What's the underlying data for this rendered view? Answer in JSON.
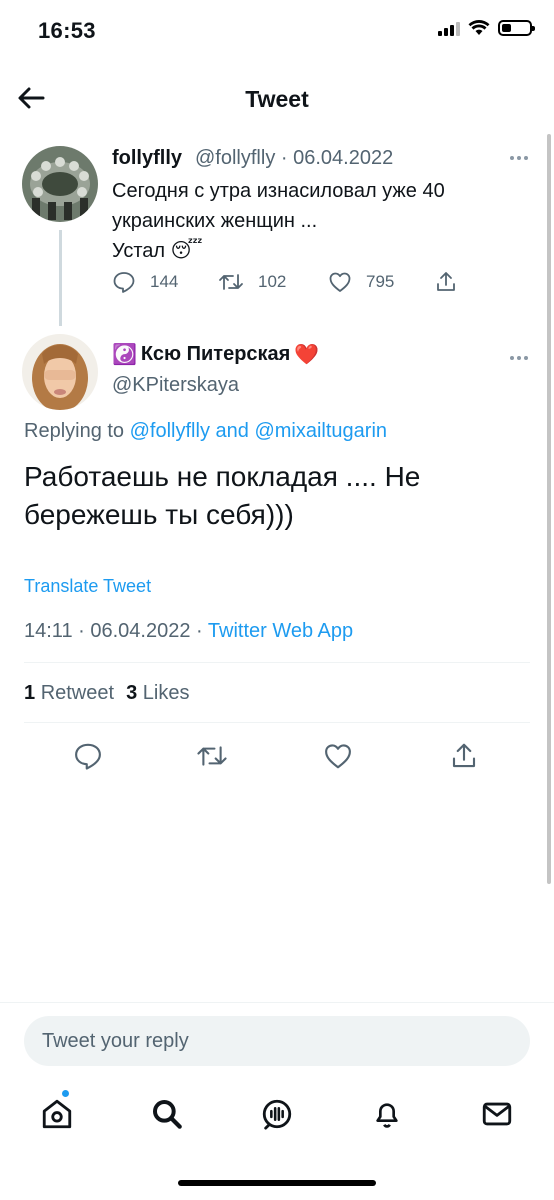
{
  "status_bar": {
    "time": "16:53"
  },
  "header": {
    "title": "Tweet"
  },
  "parent_tweet": {
    "name": "follyflly",
    "handle": "@follyflly",
    "date": "06.04.2022",
    "text_line1": "Сегодня с утра изнасиловал уже 40",
    "text_line2": "украинских женщин ...",
    "text_line3": "Устал 😴",
    "replies": "144",
    "retweets": "102",
    "likes": "795"
  },
  "reply_tweet": {
    "name": "Ксю Питерская",
    "name_prefix_emoji": "☯️",
    "name_suffix_emoji": "❤️",
    "handle": "@KPiterskaya",
    "replying_prefix": "Replying to",
    "replying_user1": "@follyflly",
    "replying_and": "and",
    "replying_user2": "@mixailtugarin",
    "text": "Работаешь не покладая .... Не бережешь ты себя)))",
    "translate": "Translate Tweet",
    "time": "14:11",
    "date": "06.04.2022",
    "source": "Twitter Web App",
    "retweet_count": "1",
    "retweet_label": "Retweet",
    "like_count": "3",
    "like_label": "Likes"
  },
  "reply_input": {
    "placeholder": "Tweet your reply"
  },
  "icons": {
    "back": "arrow-left-icon",
    "more": "more-dots-icon",
    "reply": "comment-icon",
    "retweet": "retweet-icon",
    "like": "heart-icon",
    "share": "share-icon",
    "nav": [
      "home-icon",
      "search-icon",
      "spaces-icon",
      "notifications-icon",
      "messages-icon"
    ]
  },
  "colors": {
    "accent": "#1d9bf0",
    "secondary_text": "#536471",
    "divider": "#eff3f4"
  },
  "battery_level": 0.35
}
